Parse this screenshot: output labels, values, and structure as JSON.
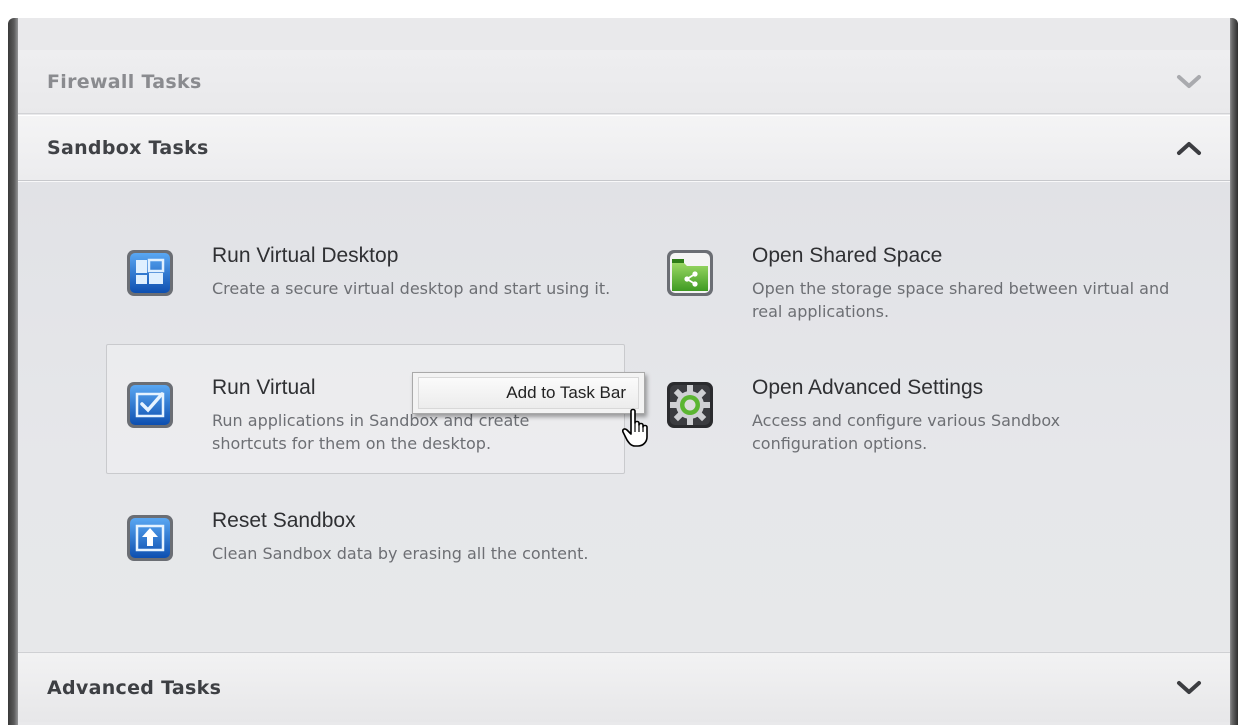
{
  "sections": {
    "firewall": {
      "title": "Firewall Tasks",
      "expanded": false
    },
    "sandbox": {
      "title": "Sandbox Tasks",
      "expanded": true
    },
    "advanced": {
      "title": "Advanced Tasks",
      "expanded": false
    }
  },
  "sandbox_tasks": [
    {
      "name": "Run Virtual Desktop",
      "description": "Create a secure virtual desktop and start using it.",
      "icon": "virtual-desktop-icon"
    },
    {
      "name": "Open Shared Space",
      "description": "Open the storage space shared between virtual and real applications.",
      "icon": "shared-folder-icon"
    },
    {
      "name": "Run Virtual",
      "description": "Run applications in Sandbox and create shortcuts for them on the desktop.",
      "icon": "checkbox-window-icon"
    },
    {
      "name": "Open Advanced Settings",
      "description": "Access and configure various Sandbox configuration options.",
      "icon": "gear-icon"
    },
    {
      "name": "Reset Sandbox",
      "description": "Clean Sandbox data by erasing all the content.",
      "icon": "upload-arrow-icon"
    }
  ],
  "context_menu": {
    "item_label": "Add to Task Bar"
  },
  "colors": {
    "accent_blue": "#1f6fd6",
    "accent_green": "#5bb531",
    "panel_bg": "#e9e9eb"
  }
}
